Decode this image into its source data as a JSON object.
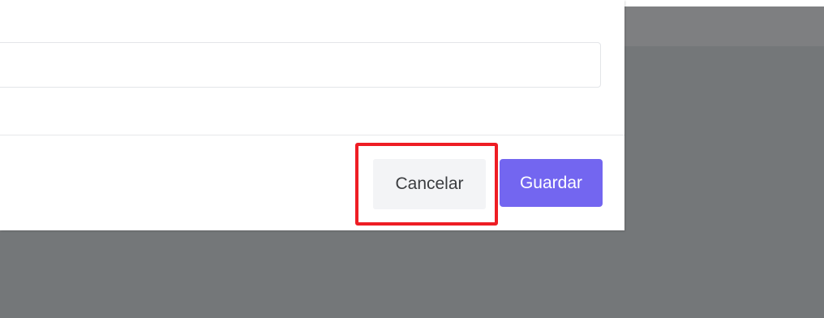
{
  "dialog": {
    "input": {
      "value": "",
      "placeholder": ""
    },
    "footer": {
      "cancel_label": "Cancelar",
      "save_label": "Guardar"
    }
  },
  "colors": {
    "primary": "#7366f0",
    "highlight": "#ee1d24",
    "overlay": "#747779"
  }
}
